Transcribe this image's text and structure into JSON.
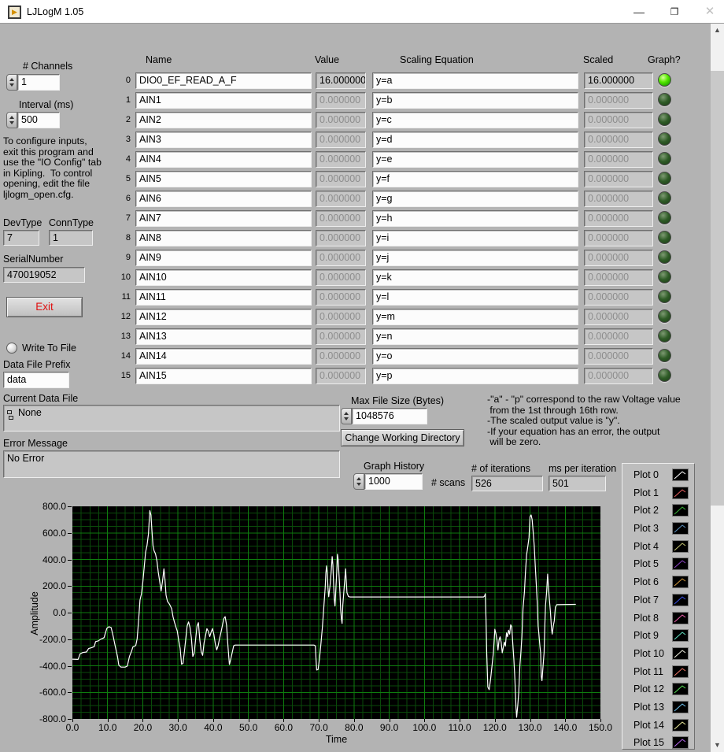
{
  "window": {
    "title": "LJLogM 1.05",
    "minimize": "—",
    "maximize": "❐",
    "close": "✕"
  },
  "left_panel": {
    "channels_label": "# Channels",
    "channels_value": "1",
    "interval_label": "Interval (ms)",
    "interval_value": "500",
    "info_lines": [
      "To configure inputs,",
      "exit this program and",
      "use the \"IO Config\" tab",
      "in Kipling.  To control",
      "opening, edit the file",
      "ljlogm_open.cfg."
    ],
    "devtype_label": "DevType",
    "devtype_value": "7",
    "conntype_label": "ConnType",
    "conntype_value": "1",
    "serial_label": "SerialNumber",
    "serial_value": "470019052",
    "exit_label": "Exit",
    "write_to_file_label": "Write To File",
    "data_file_prefix_label": "Data File Prefix",
    "data_file_prefix_value": "data",
    "current_data_file_label": "Current Data File",
    "current_data_file_value": "None",
    "error_message_label": "Error Message",
    "error_message_value": "No Error"
  },
  "table": {
    "headers": {
      "name": "Name",
      "value": "Value",
      "scaling": "Scaling Equation",
      "scaled": "Scaled",
      "graph": "Graph?"
    },
    "rows": [
      {
        "index": "0",
        "name": "DIO0_EF_READ_A_F",
        "value": "16.000000",
        "equation": "y=a",
        "scaled": "16.000000",
        "active": true,
        "led": true
      },
      {
        "index": "1",
        "name": "AIN1",
        "value": "0.000000",
        "equation": "y=b",
        "scaled": "0.000000",
        "active": false,
        "led": false
      },
      {
        "index": "2",
        "name": "AIN2",
        "value": "0.000000",
        "equation": "y=c",
        "scaled": "0.000000",
        "active": false,
        "led": false
      },
      {
        "index": "3",
        "name": "AIN3",
        "value": "0.000000",
        "equation": "y=d",
        "scaled": "0.000000",
        "active": false,
        "led": false
      },
      {
        "index": "4",
        "name": "AIN4",
        "value": "0.000000",
        "equation": "y=e",
        "scaled": "0.000000",
        "active": false,
        "led": false
      },
      {
        "index": "5",
        "name": "AIN5",
        "value": "0.000000",
        "equation": "y=f",
        "scaled": "0.000000",
        "active": false,
        "led": false
      },
      {
        "index": "6",
        "name": "AIN6",
        "value": "0.000000",
        "equation": "y=g",
        "scaled": "0.000000",
        "active": false,
        "led": false
      },
      {
        "index": "7",
        "name": "AIN7",
        "value": "0.000000",
        "equation": "y=h",
        "scaled": "0.000000",
        "active": false,
        "led": false
      },
      {
        "index": "8",
        "name": "AIN8",
        "value": "0.000000",
        "equation": "y=i",
        "scaled": "0.000000",
        "active": false,
        "led": false
      },
      {
        "index": "9",
        "name": "AIN9",
        "value": "0.000000",
        "equation": "y=j",
        "scaled": "0.000000",
        "active": false,
        "led": false
      },
      {
        "index": "10",
        "name": "AIN10",
        "value": "0.000000",
        "equation": "y=k",
        "scaled": "0.000000",
        "active": false,
        "led": false
      },
      {
        "index": "11",
        "name": "AIN11",
        "value": "0.000000",
        "equation": "y=l",
        "scaled": "0.000000",
        "active": false,
        "led": false
      },
      {
        "index": "12",
        "name": "AIN12",
        "value": "0.000000",
        "equation": "y=m",
        "scaled": "0.000000",
        "active": false,
        "led": false
      },
      {
        "index": "13",
        "name": "AIN13",
        "value": "0.000000",
        "equation": "y=n",
        "scaled": "0.000000",
        "active": false,
        "led": false
      },
      {
        "index": "14",
        "name": "AIN14",
        "value": "0.000000",
        "equation": "y=o",
        "scaled": "0.000000",
        "active": false,
        "led": false
      },
      {
        "index": "15",
        "name": "AIN15",
        "value": "0.000000",
        "equation": "y=p",
        "scaled": "0.000000",
        "active": false,
        "led": false
      }
    ]
  },
  "file_controls": {
    "max_file_size_label": "Max File Size (Bytes)",
    "max_file_size_value": "1048576",
    "change_dir_label": "Change Working Directory",
    "graph_history_label": "Graph History",
    "graph_history_value": "1000",
    "scans_label": "# scans",
    "iterations_label": "# of iterations",
    "iterations_value": "526",
    "ms_label": "ms per iteration",
    "ms_value": "501"
  },
  "notes_lines": [
    "-\"a\" - \"p\" correspond to the raw Voltage value",
    " from the 1st through 16th row.",
    "-The scaled output value is \"y\".",
    "-If your equation has an error, the output",
    " will be zero."
  ],
  "legend": {
    "items": [
      {
        "label": "Plot 0",
        "color": "#ffffff"
      },
      {
        "label": "Plot 1",
        "color": "#e86060"
      },
      {
        "label": "Plot 2",
        "color": "#39b539"
      },
      {
        "label": "Plot 3",
        "color": "#5e93c2"
      },
      {
        "label": "Plot 4",
        "color": "#c6c672"
      },
      {
        "label": "Plot 5",
        "color": "#8f45c9"
      },
      {
        "label": "Plot 6",
        "color": "#d49a3f"
      },
      {
        "label": "Plot 7",
        "color": "#3b52e8"
      },
      {
        "label": "Plot 8",
        "color": "#f060b0"
      },
      {
        "label": "Plot 9",
        "color": "#5fe0c0"
      },
      {
        "label": "Plot 10",
        "color": "#f0f0e0"
      },
      {
        "label": "Plot 11",
        "color": "#f07868"
      },
      {
        "label": "Plot 12",
        "color": "#58e058"
      },
      {
        "label": "Plot 13",
        "color": "#70c4f0"
      },
      {
        "label": "Plot 14",
        "color": "#eaea9a"
      },
      {
        "label": "Plot 15",
        "color": "#b868f0"
      }
    ]
  },
  "chart_data": {
    "type": "line",
    "xlabel": "Time",
    "ylabel": "Amplitude",
    "xlim": [
      0,
      150
    ],
    "ylim": [
      -800,
      800
    ],
    "x_ticks": [
      "0.0",
      "10.0",
      "20.0",
      "30.0",
      "40.0",
      "50.0",
      "60.0",
      "70.0",
      "80.0",
      "90.0",
      "100.0",
      "110.0",
      "120.0",
      "130.0",
      "140.0",
      "150.0"
    ],
    "y_ticks": [
      "800.0",
      "600.0",
      "400.0",
      "200.0",
      "0.0",
      "-200.0",
      "-400.0",
      "-600.0",
      "-800.0"
    ],
    "x_major": 10,
    "x_minor": 2.5,
    "y_major": 200,
    "y_minor": 50,
    "grid": true,
    "legend_position": "right",
    "bg_color": "#000000",
    "grid_major_color": "#0e7d0e",
    "grid_minor_color": "#0a4a0a",
    "line_color": "#ffffff",
    "series_name": "Plot 0",
    "points": [
      [
        0,
        -350
      ],
      [
        1.6,
        -352
      ],
      [
        2.2,
        -310
      ],
      [
        3,
        -300
      ],
      [
        4,
        -296
      ],
      [
        4.6,
        -270
      ],
      [
        5.4,
        -264
      ],
      [
        6.2,
        -256
      ],
      [
        6.6,
        -218
      ],
      [
        7.4,
        -212
      ],
      [
        8,
        -200
      ],
      [
        8.6,
        -194
      ],
      [
        9,
        -188
      ],
      [
        9.4,
        -152
      ],
      [
        9.8,
        -118
      ],
      [
        10.4,
        -106
      ],
      [
        11,
        -112
      ],
      [
        11.6,
        -180
      ],
      [
        12.2,
        -258
      ],
      [
        12.8,
        -330
      ],
      [
        13.2,
        -396
      ],
      [
        13.8,
        -410
      ],
      [
        15,
        -410
      ],
      [
        15.6,
        -402
      ],
      [
        16.2,
        -330
      ],
      [
        16.8,
        -290
      ],
      [
        17.2,
        -258
      ],
      [
        18,
        -248
      ],
      [
        18.4,
        -196
      ],
      [
        18.8,
        -60
      ],
      [
        19.2,
        95
      ],
      [
        19.6,
        140
      ],
      [
        20,
        230
      ],
      [
        20.4,
        345
      ],
      [
        20.8,
        455
      ],
      [
        21.2,
        505
      ],
      [
        21.6,
        590
      ],
      [
        22,
        768
      ],
      [
        22.3,
        735
      ],
      [
        22.6,
        615
      ],
      [
        22.9,
        505
      ],
      [
        23.2,
        465
      ],
      [
        23.6,
        442
      ],
      [
        24,
        390
      ],
      [
        24.4,
        305
      ],
      [
        24.8,
        235
      ],
      [
        25.2,
        162
      ],
      [
        25.6,
        235
      ],
      [
        26,
        330
      ],
      [
        26.3,
        250
      ],
      [
        26.6,
        132
      ],
      [
        27,
        85
      ],
      [
        27.6,
        62
      ],
      [
        28.2,
        30
      ],
      [
        28.6,
        -32
      ],
      [
        29,
        -72
      ],
      [
        29.4,
        -108
      ],
      [
        29.8,
        -140
      ],
      [
        30.2,
        -210
      ],
      [
        30.6,
        -268
      ],
      [
        31,
        -388
      ],
      [
        31.4,
        -382
      ],
      [
        31.8,
        -295
      ],
      [
        32.2,
        -200
      ],
      [
        32.6,
        -100
      ],
      [
        33,
        -70
      ],
      [
        33.4,
        -110
      ],
      [
        33.8,
        -190
      ],
      [
        34.2,
        -330
      ],
      [
        34.6,
        -305
      ],
      [
        35,
        -200
      ],
      [
        35.4,
        -100
      ],
      [
        35.8,
        -75
      ],
      [
        36.2,
        -205
      ],
      [
        36.6,
        -295
      ],
      [
        37,
        -322
      ],
      [
        37.4,
        -228
      ],
      [
        37.8,
        -175
      ],
      [
        38.2,
        -120
      ],
      [
        38.6,
        -140
      ],
      [
        39,
        -180
      ],
      [
        39.4,
        -148
      ],
      [
        39.8,
        -120
      ],
      [
        40.2,
        -165
      ],
      [
        40.6,
        -235
      ],
      [
        41,
        -280
      ],
      [
        41.4,
        -248
      ],
      [
        41.8,
        -195
      ],
      [
        42.2,
        -148
      ],
      [
        42.6,
        -98
      ],
      [
        43,
        -45
      ],
      [
        43.4,
        -30
      ],
      [
        43.8,
        -95
      ],
      [
        44.2,
        -255
      ],
      [
        44.6,
        -390
      ],
      [
        45,
        -348
      ],
      [
        45.4,
        -300
      ],
      [
        45.8,
        -250
      ],
      [
        46.2,
        -244
      ],
      [
        68.6,
        -244
      ],
      [
        69,
        -250
      ],
      [
        69.2,
        -355
      ],
      [
        69.4,
        -432
      ],
      [
        69.8,
        -428
      ],
      [
        70.2,
        -345
      ],
      [
        70.6,
        -235
      ],
      [
        71,
        -115
      ],
      [
        71.4,
        35
      ],
      [
        71.8,
        185
      ],
      [
        72,
        300
      ],
      [
        72.2,
        352
      ],
      [
        72.4,
        298
      ],
      [
        72.6,
        180
      ],
      [
        72.8,
        120
      ],
      [
        73.2,
        205
      ],
      [
        73.5,
        305
      ],
      [
        73.8,
        422
      ],
      [
        74,
        360
      ],
      [
        74.2,
        220
      ],
      [
        74.4,
        100
      ],
      [
        74.6,
        50
      ],
      [
        74.8,
        155
      ],
      [
        75.1,
        305
      ],
      [
        75.3,
        440
      ],
      [
        75.5,
        398
      ],
      [
        75.8,
        250
      ],
      [
        76,
        150
      ],
      [
        76.2,
        20
      ],
      [
        76.4,
        -45
      ],
      [
        76.6,
        -82
      ],
      [
        76.8,
        55
      ],
      [
        77.1,
        155
      ],
      [
        77.4,
        255
      ],
      [
        77.6,
        330
      ],
      [
        77.8,
        240
      ],
      [
        78,
        150
      ],
      [
        78.4,
        122
      ],
      [
        78.8,
        118
      ],
      [
        116.8,
        118
      ],
      [
        117.1,
        125
      ],
      [
        117.3,
        142
      ],
      [
        117.5,
        -55
      ],
      [
        117.7,
        -305
      ],
      [
        118,
        -560
      ],
      [
        118.4,
        -580
      ],
      [
        118.8,
        -500
      ],
      [
        119.2,
        -400
      ],
      [
        119.6,
        -300
      ],
      [
        120,
        -125
      ],
      [
        120.3,
        -155
      ],
      [
        120.6,
        -205
      ],
      [
        120.9,
        -282
      ],
      [
        121.2,
        -205
      ],
      [
        121.5,
        -182
      ],
      [
        121.8,
        -225
      ],
      [
        122.1,
        -302
      ],
      [
        122.4,
        -262
      ],
      [
        122.7,
        -222
      ],
      [
        123,
        -252
      ],
      [
        123.3,
        -152
      ],
      [
        123.6,
        -182
      ],
      [
        123.9,
        -132
      ],
      [
        124.2,
        -162
      ],
      [
        124.5,
        -92
      ],
      [
        124.8,
        -105
      ],
      [
        125.1,
        -232
      ],
      [
        125.4,
        -355
      ],
      [
        125.7,
        -502
      ],
      [
        126,
        -705
      ],
      [
        126.2,
        -788
      ],
      [
        126.5,
        -700
      ],
      [
        126.8,
        -600
      ],
      [
        127.1,
        -400
      ],
      [
        127.4,
        -300
      ],
      [
        127.7,
        -180
      ],
      [
        128,
        30
      ],
      [
        128.4,
        155
      ],
      [
        128.7,
        302
      ],
      [
        129,
        432
      ],
      [
        129.4,
        502
      ],
      [
        129.7,
        565
      ],
      [
        130,
        722
      ],
      [
        130.3,
        735
      ],
      [
        130.6,
        700
      ],
      [
        130.9,
        600
      ],
      [
        131.2,
        500
      ],
      [
        131.5,
        350
      ],
      [
        131.8,
        200
      ],
      [
        132.1,
        50
      ],
      [
        132.3,
        -100
      ],
      [
        132.5,
        -155
      ],
      [
        132.8,
        -255
      ],
      [
        133,
        -305
      ],
      [
        133.2,
        -482
      ],
      [
        133.4,
        -512
      ],
      [
        133.7,
        -400
      ],
      [
        134,
        -300
      ],
      [
        134.2,
        -100
      ],
      [
        134.4,
        55
      ],
      [
        134.7,
        155
      ],
      [
        135,
        290
      ],
      [
        135.2,
        200
      ],
      [
        135.5,
        100
      ],
      [
        135.8,
        0
      ],
      [
        136.1,
        -120
      ],
      [
        136.3,
        -162
      ],
      [
        136.6,
        -100
      ],
      [
        136.9,
        -60
      ],
      [
        137.2,
        40
      ],
      [
        137.6,
        60
      ],
      [
        143,
        62
      ]
    ]
  },
  "colors": {
    "panel": "#b3b3b3",
    "led_on": "#55e800",
    "led_off": "#2f5c27",
    "exit_text": "#e01010"
  }
}
